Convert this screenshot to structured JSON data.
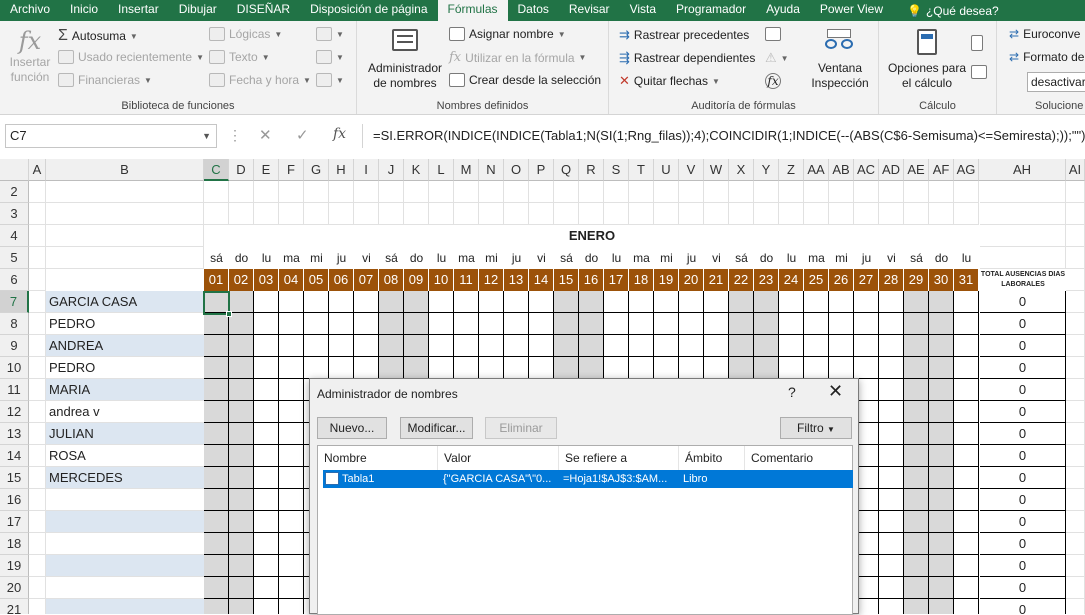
{
  "tabs": [
    "Archivo",
    "Inicio",
    "Insertar",
    "Dibujar",
    "DISEÑAR",
    "Disposición de página",
    "Fórmulas",
    "Datos",
    "Revisar",
    "Vista",
    "Programador",
    "Ayuda",
    "Power View"
  ],
  "active_tab": "Fórmulas",
  "help_search": "¿Qué desea?",
  "ribbon": {
    "insert_function": "Insertar\nfunción",
    "autosuma": "Autosuma",
    "usado_recientemente": "Usado recientemente",
    "financieras": "Financieras",
    "logicas": "Lógicas",
    "texto": "Texto",
    "fecha_hora": "Fecha y hora",
    "group_library": "Biblioteca de funciones",
    "admin_nombres": "Administrador\nde nombres",
    "asignar_nombre": "Asignar nombre",
    "utilizar_formula": "Utilizar en la fórmula",
    "crear_seleccion": "Crear desde la selección",
    "group_names": "Nombres definidos",
    "rastrear_precedentes": "Rastrear precedentes",
    "rastrear_dependientes": "Rastrear dependientes",
    "quitar_flechas": "Quitar flechas",
    "group_audit": "Auditoría de fórmulas",
    "ventana_inspeccion": "Ventana\nInspección",
    "opciones_calculo": "Opciones para\nel cálculo",
    "group_calc": "Cálculo",
    "euroconv": "Euroconve",
    "formato_de": "Formato de",
    "desactivar": "desactivar",
    "group_solutions": "Solucione"
  },
  "namebox": "C7",
  "formula": "=SI.ERROR(INDICE(INDICE(Tabla1;N(SI(1;Rng_filas));4);COINCIDIR(1;INDICE(--(ABS(C$6-Semisuma)<=Semiresta);));\"\")",
  "col_a": "A",
  "col_b": "B",
  "col_ah": "AH",
  "col_ai": "AI",
  "day_cols": [
    "C",
    "D",
    "E",
    "F",
    "G",
    "H",
    "I",
    "J",
    "K",
    "L",
    "M",
    "N",
    "O",
    "P",
    "Q",
    "R",
    "S",
    "T",
    "U",
    "V",
    "W",
    "X",
    "Y",
    "Z",
    "AA",
    "AB",
    "AC",
    "AD",
    "AE",
    "AF",
    "AG"
  ],
  "row_numbers": [
    "2",
    "3",
    "4",
    "5",
    "6",
    "7",
    "8",
    "9",
    "10",
    "11",
    "12",
    "13",
    "14",
    "15",
    "16",
    "17",
    "18",
    "19",
    "20",
    "21"
  ],
  "month_title": "ENERO",
  "day_names": [
    "sá",
    "do",
    "lu",
    "ma",
    "mi",
    "ju",
    "vi",
    "sá",
    "do",
    "lu",
    "ma",
    "mi",
    "ju",
    "vi",
    "sá",
    "do",
    "lu",
    "ma",
    "mi",
    "ju",
    "vi",
    "sá",
    "do",
    "lu",
    "ma",
    "mi",
    "ju",
    "vi",
    "sá",
    "do",
    "lu"
  ],
  "day_numbers": [
    "01",
    "02",
    "03",
    "04",
    "05",
    "06",
    "07",
    "08",
    "09",
    "10",
    "11",
    "12",
    "13",
    "14",
    "15",
    "16",
    "17",
    "18",
    "19",
    "20",
    "21",
    "22",
    "23",
    "24",
    "25",
    "26",
    "27",
    "28",
    "29",
    "30",
    "31"
  ],
  "weekend_days": [
    "01",
    "02",
    "08",
    "09",
    "15",
    "16",
    "22",
    "23",
    "29",
    "30"
  ],
  "total_label": "TOTAL AUSENCIAS DIAS LABORALES",
  "names": [
    "GARCIA CASA",
    "PEDRO",
    "ANDREA",
    "PEDRO",
    "MARIA",
    "andrea v",
    "JULIAN",
    "ROSA",
    "MERCEDES",
    "",
    "",
    "",
    "",
    "",
    ""
  ],
  "totals": [
    "0",
    "0",
    "0",
    "0",
    "0",
    "0",
    "0",
    "0",
    "0",
    "0",
    "0",
    "0",
    "0",
    "0",
    "0"
  ],
  "dialog": {
    "title": "Administrador de nombres",
    "help": "?",
    "close": "✕",
    "btn_nuevo": "Nuevo...",
    "btn_modificar": "Modificar...",
    "btn_eliminar": "Eliminar",
    "btn_filtro": "Filtro",
    "col_nombre": "Nombre",
    "col_valor": "Valor",
    "col_refiere": "Se refiere a",
    "col_ambito": "Ámbito",
    "col_comentario": "Comentario",
    "row": {
      "nombre": "Tabla1",
      "valor": "{\"GARCIA CASA\"\\\"0...",
      "refiere": "=Hoja1!$AJ$3:$AM...",
      "ambito": "Libro",
      "comentario": ""
    }
  },
  "colors": {
    "ribbon_green": "#217346",
    "day_header": "#9c5209",
    "weekend": "#d9d9d9",
    "name_band": "#dce6f1",
    "selection": "#0078d7"
  }
}
